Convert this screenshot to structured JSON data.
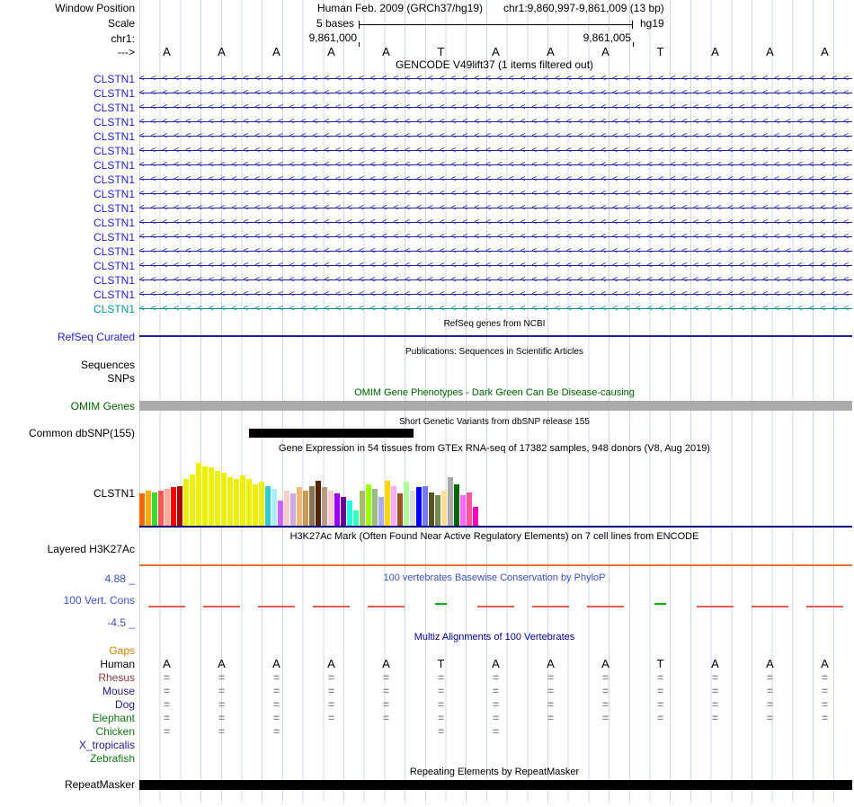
{
  "header": {
    "window_position_label": "Window Position",
    "assembly": "Human Feb. 2009 (GRCh37/hg19)",
    "position": "chr1:9,860,997-9,861,009 (13 bp)",
    "scale_label": "Scale",
    "scale_value": "5 bases",
    "assembly_short": "hg19",
    "chrom_label": "chr1:",
    "coord_left": "9,861,000",
    "coord_right": "9,861,005",
    "strand_label": "--->"
  },
  "sequence": {
    "bases": [
      "A",
      "A",
      "A",
      "A",
      "A",
      "T",
      "A",
      "A",
      "A",
      "T",
      "A",
      "A",
      "A"
    ]
  },
  "gencode": {
    "title": "GENCODE V49lift37 (1 items filtered out)",
    "rows": [
      {
        "label": "CLSTN1",
        "style": "blue"
      },
      {
        "label": "CLSTN1",
        "style": "blue"
      },
      {
        "label": "CLSTN1",
        "style": "blue"
      },
      {
        "label": "CLSTN1",
        "style": "blue"
      },
      {
        "label": "CLSTN1",
        "style": "blue"
      },
      {
        "label": "CLSTN1",
        "style": "blue"
      },
      {
        "label": "CLSTN1",
        "style": "blue"
      },
      {
        "label": "CLSTN1",
        "style": "blue"
      },
      {
        "label": "CLSTN1",
        "style": "blue"
      },
      {
        "label": "CLSTN1",
        "style": "blue"
      },
      {
        "label": "CLSTN1",
        "style": "blue"
      },
      {
        "label": "CLSTN1",
        "style": "blue"
      },
      {
        "label": "CLSTN1",
        "style": "blue"
      },
      {
        "label": "CLSTN1",
        "style": "blue"
      },
      {
        "label": "CLSTN1",
        "style": "blue"
      },
      {
        "label": "CLSTN1",
        "style": "blue"
      },
      {
        "label": "CLSTN1",
        "style": "teal"
      }
    ]
  },
  "refseq": {
    "title": "RefSeq genes from NCBI",
    "label": "RefSeq Curated"
  },
  "publications": {
    "title": "Publications: Sequences in Scientific Articles",
    "sequences_label": "Sequences",
    "snps_label": "SNPs"
  },
  "omim": {
    "title": "OMIM Gene Phenotypes - Dark Green Can Be Disease-causing",
    "label": "OMIM Genes"
  },
  "dbsnp": {
    "title": "Short Genetic Variants from dbSNP release 155",
    "label": "Common dbSNP(155)"
  },
  "gtex": {
    "title": "Gene Expression in 54 tissues from GTEx RNA-seq of 17382 samples, 948 donors (V8, Aug 2019)",
    "label": "CLSTN1",
    "chart_data": {
      "type": "bar",
      "title": "Gene Expression in 54 tissues from GTEx RNA-seq of 17382 samples, 948 donors (V8, Aug 2019)",
      "gene": "CLSTN1",
      "n_bars": 54,
      "value_unit": "relative_height_fraction",
      "values": [
        0.5,
        0.55,
        0.52,
        0.55,
        0.58,
        0.6,
        0.62,
        0.72,
        0.8,
        0.97,
        0.92,
        0.9,
        0.85,
        0.82,
        0.75,
        0.72,
        0.78,
        0.73,
        0.65,
        0.68,
        0.62,
        0.58,
        0.4,
        0.55,
        0.5,
        0.6,
        0.55,
        0.62,
        0.7,
        0.6,
        0.55,
        0.5,
        0.45,
        0.4,
        0.25,
        0.55,
        0.65,
        0.58,
        0.45,
        0.7,
        0.62,
        0.5,
        0.68,
        0.55,
        0.6,
        0.62,
        0.52,
        0.48,
        0.55,
        0.75,
        0.65,
        0.48,
        0.52,
        0.3
      ],
      "colors": [
        "#FF6600",
        "#FFAA00",
        "#33DD33",
        "#FF5555",
        "#FFAA99",
        "#FF0000",
        "#AA0000",
        "#EEEE00",
        "#EEEE00",
        "#EEEE00",
        "#EEEE00",
        "#EEEE00",
        "#EEEE00",
        "#EEEE00",
        "#EEEE00",
        "#EEEE00",
        "#EEEE00",
        "#EEEE00",
        "#EEEE00",
        "#EEEE00",
        "#33CCCC",
        "#AAEEFF",
        "#CC66FF",
        "#FFCCCC",
        "#CCAADD",
        "#EEBB77",
        "#CC9955",
        "#8B7355",
        "#552200",
        "#BB9988",
        "#FFCCCC",
        "#9900FF",
        "#660099",
        "#22FFDD",
        "#33FFC2",
        "#AABB66",
        "#99FF00",
        "#99BB88",
        "#AAAAFF",
        "#FFD700",
        "#FFAAFF",
        "#995522",
        "#AAFF99",
        "#DDDDDD",
        "#0000FF",
        "#7777FF",
        "#555522",
        "#778855",
        "#FFDD99",
        "#AAAAAA",
        "#006600",
        "#FF66FF",
        "#FF5599",
        "#FF00BB"
      ],
      "xlabel": "",
      "ylabel": ""
    }
  },
  "h3k27ac": {
    "title": "H3K27Ac Mark (Often Found Near Active Regulatory Elements) on 7 cell lines from ENCODE",
    "label": "Layered H3K27Ac"
  },
  "conservation": {
    "title": "100 vertebrates Basewise Conservation by PhyloP",
    "label": "100 Vert. Cons",
    "max_label": "4.88 _",
    "min_label": "-4.5 _",
    "negative_mark_positions": [
      0,
      1,
      2,
      3,
      4,
      6,
      7,
      8,
      10,
      11,
      12
    ],
    "positive_mark_positions": [
      5,
      9
    ]
  },
  "multiz": {
    "title": "Multiz Alignments of 100 Vertebrates",
    "species": [
      {
        "name": "Gaps",
        "color_key": "gaps",
        "pattern": "none"
      },
      {
        "name": "Human",
        "color_key": "black",
        "pattern": "bases"
      },
      {
        "name": "Rhesus",
        "color_key": "rhesus",
        "pattern": "all"
      },
      {
        "name": "Mouse",
        "color_key": "navy",
        "pattern": "all"
      },
      {
        "name": "Dog",
        "color_key": "navy",
        "pattern": "all"
      },
      {
        "name": "Elephant",
        "color_key": "green",
        "pattern": "all"
      },
      {
        "name": "Chicken",
        "color_key": "green",
        "pattern": "partial",
        "cols": [
          0,
          1,
          2,
          5,
          6
        ]
      },
      {
        "name": "X_tropicalis",
        "color_key": "navy",
        "pattern": "none"
      },
      {
        "name": "Zebrafish",
        "color_key": "green",
        "pattern": "none"
      }
    ]
  },
  "repeatmasker": {
    "title": "Repeating Elements by RepeatMasker",
    "label": "RepeatMasker"
  },
  "colors": {
    "gene_line": "#2020a8",
    "gene_label": "#2222cc",
    "teal_line": "#008b8b",
    "teal_label": "#009595",
    "omim_green": "#006400",
    "omim_gray": "#aaaaaa",
    "navy_line": "#000080",
    "h3k_orange": "#e8722a",
    "cons_blue": "#3c50c0",
    "cons_red": "#e06050",
    "cons_green": "#00b400",
    "multiz_navy": "#00008b",
    "gaps": "#cc8400",
    "black": "#000000",
    "rhesus": "#8b3a3a",
    "navy": "#20208c",
    "green": "#117711",
    "eq": "#909090",
    "grid": "#ccd8ea"
  }
}
